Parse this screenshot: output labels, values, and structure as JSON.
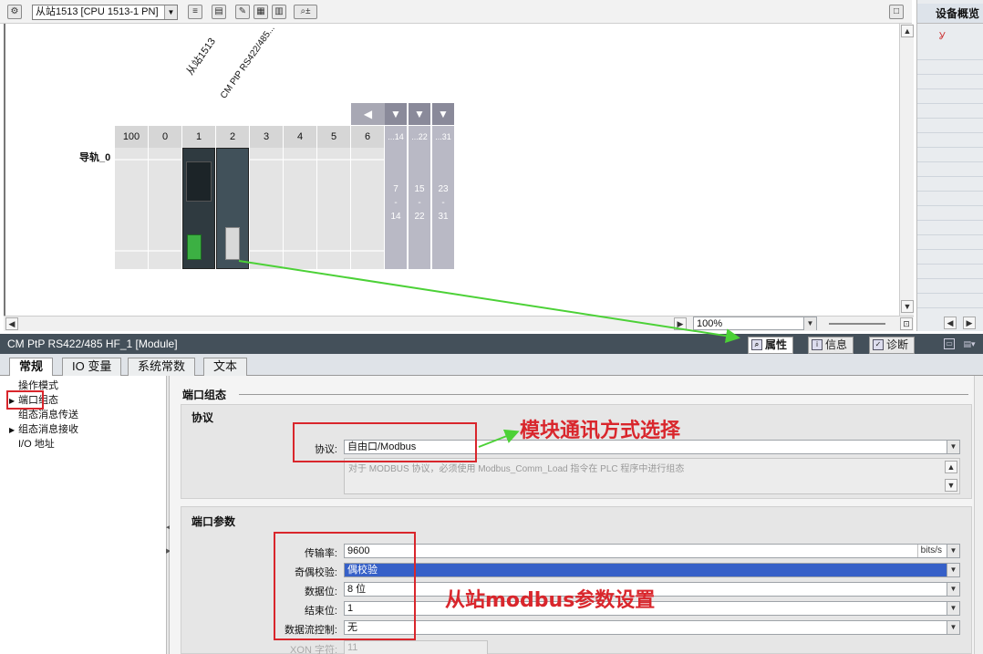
{
  "toolbar": {
    "device_selector": "从站1513 [CPU 1513-1 PN]"
  },
  "device_view": {
    "rotated_labels": [
      "从站1513",
      "CM PtP RS422/485..."
    ],
    "rail_label": "导轨_0",
    "slot_numbers": [
      "100",
      "0",
      "1",
      "2",
      "3",
      "4",
      "5",
      "6"
    ],
    "expansion_heads": [
      "...14",
      "...22",
      "...31"
    ],
    "expansion_starts": [
      "7",
      "15",
      "23"
    ],
    "expansion_dashes": [
      "-",
      "-",
      "-"
    ],
    "expansion_ends": [
      "14",
      "22",
      "31"
    ],
    "zoom": "100%"
  },
  "overview": {
    "title": "设备概览"
  },
  "properties": {
    "title": "CM PtP RS422/485 HF_1 [Module]",
    "tabs": [
      "属性",
      "信息",
      "诊断"
    ],
    "subtabs": [
      "常规",
      "IO 变量",
      "系统常数",
      "文本"
    ],
    "nav": [
      "操作模式",
      "端口组态",
      "组态消息传送",
      "组态消息接收",
      "I/O 地址"
    ],
    "section_port_config": "端口组态",
    "group_protocol": "协议",
    "protocol_label": "协议:",
    "protocol_value": "自由口/Modbus",
    "protocol_hint": "对于 MODBUS 协议，必须使用 Modbus_Comm_Load 指令在 PLC 程序中进行组态",
    "group_port_params": "端口参数",
    "params": [
      {
        "label": "传输率:",
        "value": "9600",
        "unit": "bits/s"
      },
      {
        "label": "奇偶校验:",
        "value": "偶校验"
      },
      {
        "label": "数据位:",
        "value": "8 位"
      },
      {
        "label": "结束位:",
        "value": "1"
      },
      {
        "label": "数据流控制:",
        "value": "无"
      }
    ],
    "xon_label": "XON 字符:",
    "xon_value": "11"
  },
  "annotations": {
    "protocol_note": "模块通讯方式选择",
    "params_note": "从站modbus参数设置"
  },
  "colors": {
    "annotation_red": "#d9262c",
    "arrow_green": "#4cd137",
    "selection_blue": "#3660c8"
  }
}
